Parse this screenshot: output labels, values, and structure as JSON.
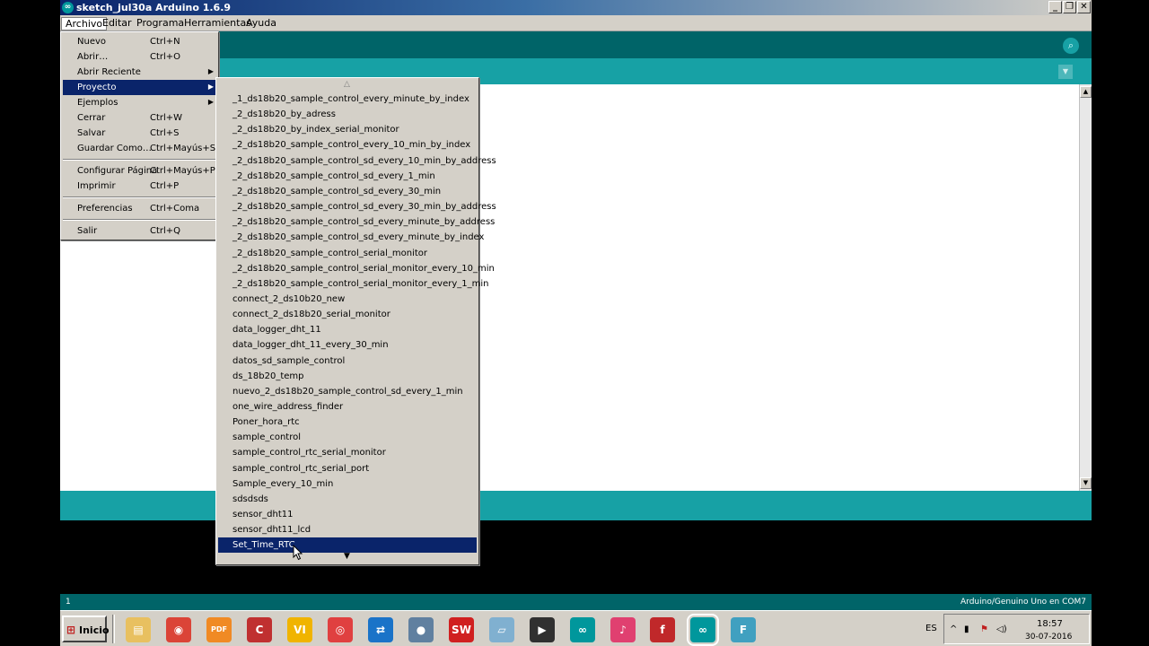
{
  "window": {
    "title": "sketch_jul30a Arduino 1.6.9",
    "app_icon": "∞",
    "minimize": "_",
    "restore": "❐",
    "close": "✕"
  },
  "menubar": [
    "Archivo",
    "Editar",
    "Programa",
    "Herramientas",
    "Ayuda"
  ],
  "archivo_menu": {
    "items": [
      {
        "label": "Nuevo",
        "shortcut": "Ctrl+N"
      },
      {
        "label": "Abrir…",
        "shortcut": "Ctrl+O"
      },
      {
        "label": "Abrir Reciente",
        "shortcut": ""
      },
      {
        "label": "Proyecto",
        "shortcut": ""
      },
      {
        "label": "Ejemplos",
        "shortcut": ""
      },
      {
        "label": "Cerrar",
        "shortcut": "Ctrl+W"
      },
      {
        "label": "Salvar",
        "shortcut": "Ctrl+S"
      },
      {
        "label": "Guardar Como…",
        "shortcut": "Ctrl+Mayús+S"
      },
      {
        "label": "Configurar Página",
        "shortcut": "Ctrl+Mayús+P"
      },
      {
        "label": "Imprimir",
        "shortcut": "Ctrl+P"
      },
      {
        "label": "Preferencias",
        "shortcut": "Ctrl+Coma"
      },
      {
        "label": "Salir",
        "shortcut": "Ctrl+Q"
      }
    ],
    "submenu_arrow": "▶"
  },
  "proyecto_menu": {
    "scroll_up": "△",
    "scroll_down": "▼",
    "items": [
      "_1_ds18b20_sample_control_every_minute_by_index",
      "_2_ds18b20_by_adress",
      "_2_ds18b20_by_index_serial_monitor",
      "_2_ds18b20_sample_control_every_10_min_by_index",
      "_2_ds18b20_sample_control_sd_every_10_min_by_address",
      "_2_ds18b20_sample_control_sd_every_1_min",
      "_2_ds18b20_sample_control_sd_every_30_min",
      "_2_ds18b20_sample_control_sd_every_30_min_by_address",
      "_2_ds18b20_sample_control_sd_every_minute_by_address",
      "_2_ds18b20_sample_control_sd_every_minute_by_index",
      "_2_ds18b20_sample_control_serial_monitor",
      "_2_ds18b20_sample_control_serial_monitor_every_10_min",
      "_2_ds18b20_sample_control_serial_monitor_every_1_min",
      "connect_2_ds10b20_new",
      "connect_2_ds18b20_serial_monitor",
      "data_logger_dht_11",
      "data_logger_dht_11_every_30_min",
      "datos_sd_sample_control",
      "ds_18b20_temp",
      "nuevo_2_ds18b20_sample_control_sd_every_1_min",
      "one_wire_address_finder",
      "Poner_hora_rtc",
      "sample_control",
      "sample_control_rtc_serial_monitor",
      "sample_control_rtc_serial_port",
      "Sample_every_10_min",
      "sdsdsds",
      "sensor_dht11",
      "sensor_dht11_lcd",
      "Set_Time_RTC"
    ],
    "highlighted": "Set_Time_RTC"
  },
  "toolbar": {
    "serial_monitor_icon": "⌕",
    "tab_menu_icon": "▼"
  },
  "editor_scroll": {
    "up": "▲",
    "down": "▼"
  },
  "footer": {
    "line": "1",
    "board": "Arduino/Genuino Uno en COM7"
  },
  "taskbar": {
    "start_label": "Inicio",
    "start_logo": "⊞",
    "apps": [
      {
        "name": "explorer-icon",
        "glyph": "▤",
        "color": "#e8c060"
      },
      {
        "name": "chrome-icon",
        "glyph": "◉",
        "color": "#db4437"
      },
      {
        "name": "pdf-icon",
        "glyph": "PDF",
        "color": "#f08a24"
      },
      {
        "name": "ccleaner-icon",
        "glyph": "C",
        "color": "#c03030"
      },
      {
        "name": "vi-icon",
        "glyph": "VI",
        "color": "#f0b400"
      },
      {
        "name": "app-icon-6",
        "glyph": "◎",
        "color": "#e04040"
      },
      {
        "name": "teamviewer-icon",
        "glyph": "⇄",
        "color": "#1a73c8"
      },
      {
        "name": "globe-icon",
        "glyph": "●",
        "color": "#6080a0"
      },
      {
        "name": "solidworks-icon",
        "glyph": "SW",
        "color": "#d02020"
      },
      {
        "name": "box-icon",
        "glyph": "▱",
        "color": "#80b0d0"
      },
      {
        "name": "film-icon",
        "glyph": "▶",
        "color": "#303030"
      },
      {
        "name": "arduino-icon",
        "glyph": "∞",
        "color": "#00979c"
      },
      {
        "name": "itunes-icon",
        "glyph": "♪",
        "color": "#e04070"
      },
      {
        "name": "fritzing-red-icon",
        "glyph": "f",
        "color": "#c0282a"
      },
      {
        "name": "arduino-active-icon",
        "glyph": "∞",
        "color": "#00979c"
      },
      {
        "name": "fritzing-icon",
        "glyph": "F",
        "color": "#40a0c0"
      }
    ],
    "lang": "ES",
    "tray_icons": [
      "^",
      "▮",
      "⚑",
      "◁)"
    ],
    "time": "18:57",
    "date": "30-07-2016"
  }
}
